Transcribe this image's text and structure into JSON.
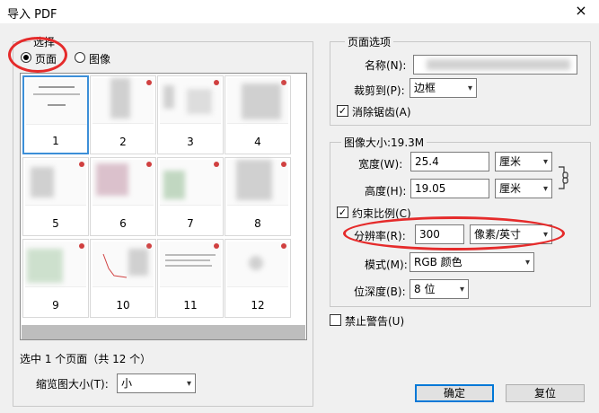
{
  "window": {
    "title": "导入 PDF",
    "close": "×"
  },
  "select_group": {
    "legend": "选择",
    "radio_pages": "页面",
    "radio_images": "图像",
    "selected": "pages",
    "thumbnails": [
      "1",
      "2",
      "3",
      "4",
      "5",
      "6",
      "7",
      "8",
      "9",
      "10",
      "11",
      "12"
    ],
    "selected_page": "1",
    "status": "选中 1 个页面（共 12 个）",
    "thumb_size_label": "缩览图大小(T):",
    "thumb_size_value": "小"
  },
  "page_options": {
    "legend": "页面选项",
    "name_label": "名称(N):",
    "crop_label": "裁剪到(P):",
    "crop_value": "边框",
    "anti_alias_label": "消除锯齿(A)",
    "anti_alias_checked": true
  },
  "image_size": {
    "legend": "图像大小:19.3M",
    "width_label": "宽度(W):",
    "width_value": "25.4",
    "width_unit": "厘米",
    "height_label": "高度(H):",
    "height_value": "19.05",
    "height_unit": "厘米",
    "constrain_label": "约束比例(C)",
    "constrain_checked": true,
    "resolution_label": "分辨率(R):",
    "resolution_value": "300",
    "resolution_unit": "像素/英寸",
    "mode_label": "模式(M):",
    "mode_value": "RGB 颜色",
    "depth_label": "位深度(B):",
    "depth_value": "8 位"
  },
  "suppress_label": "禁止警告(U)",
  "ok_button": "确定",
  "reset_button": "复位",
  "colors": {
    "highlight": "#e52b2b",
    "selection": "#3c8fd8",
    "default_button": "#0078d7"
  }
}
